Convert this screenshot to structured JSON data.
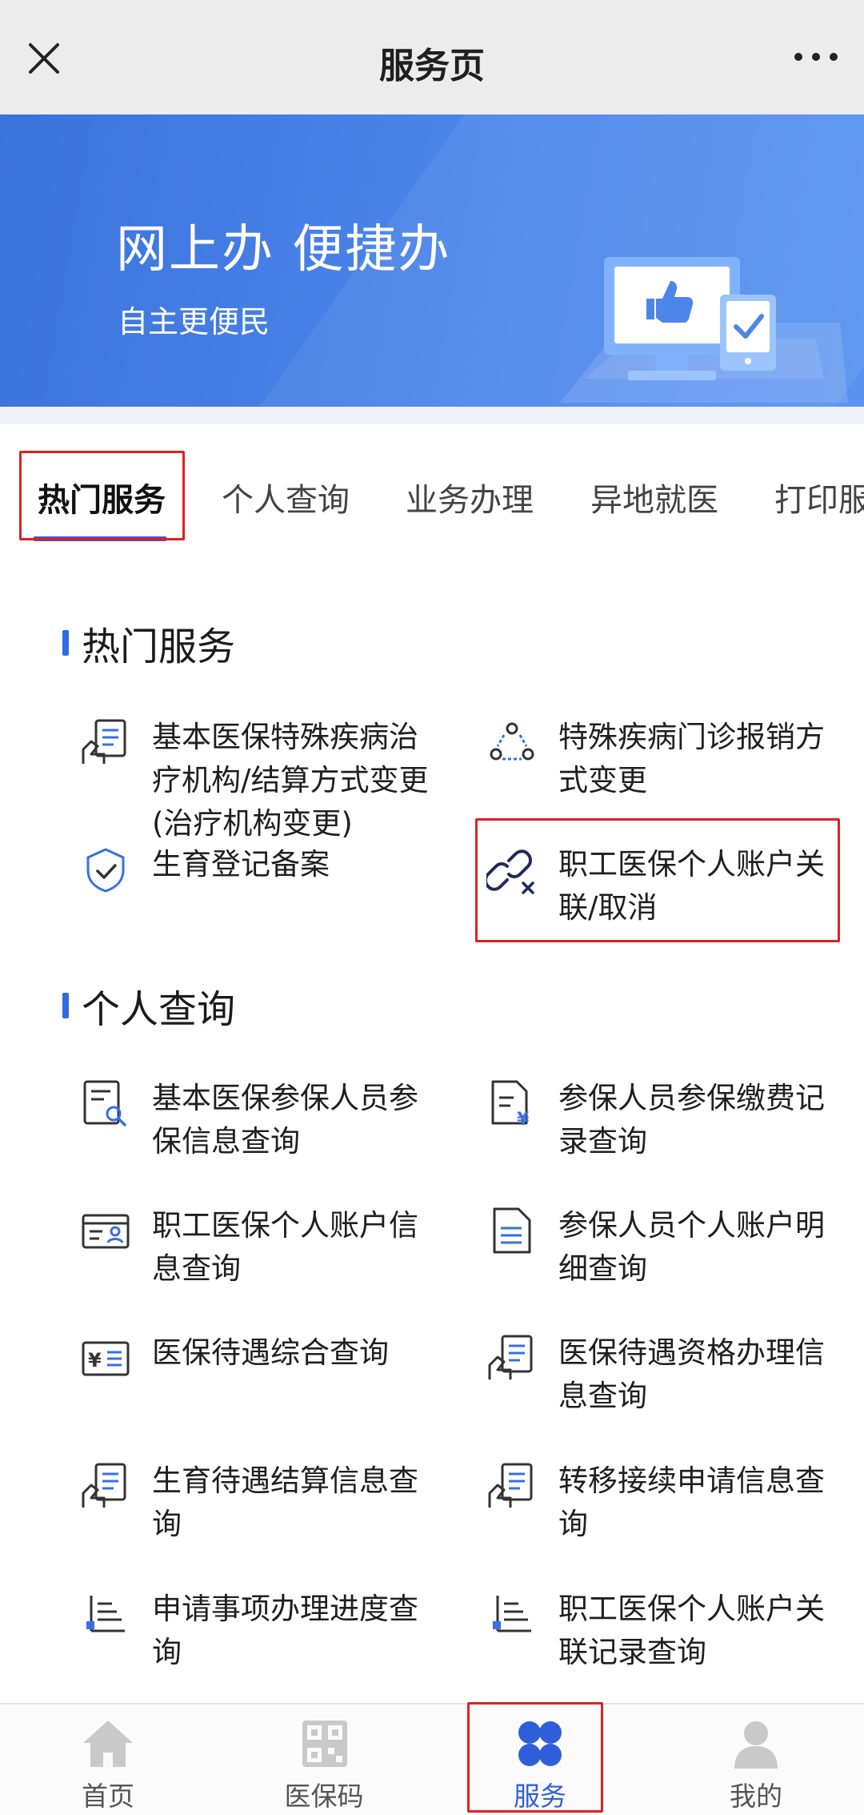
{
  "topbar": {
    "title": "服务页",
    "close_icon": "close-icon",
    "more_icon": "more-dots-icon"
  },
  "banner": {
    "headline": "网上办 便捷办",
    "subtitle": "自主更便民",
    "illustration": "computer-thumbs-up-illustration"
  },
  "tabs": [
    {
      "label": "热门服务",
      "active": true
    },
    {
      "label": "个人查询",
      "active": false
    },
    {
      "label": "业务办理",
      "active": false
    },
    {
      "label": "异地就医",
      "active": false
    },
    {
      "label": "打印服",
      "active": false
    }
  ],
  "sections": [
    {
      "title": "热门服务",
      "items": [
        {
          "label": "基本医保特殊疾病治疗机构/结算方式变更(治疗机构变更)",
          "icon": "document-hand-icon"
        },
        {
          "label": "特殊疾病门诊报销方式变更",
          "icon": "nodes-triangle-icon"
        },
        {
          "label": "生育登记备案",
          "icon": "shield-check-icon"
        },
        {
          "label": "职工医保个人账户关联/取消",
          "icon": "link-cancel-icon"
        }
      ]
    },
    {
      "title": "个人查询",
      "items": [
        {
          "label": "基本医保参保人员参保信息查询",
          "icon": "doc-search-icon"
        },
        {
          "label": "参保人员参保缴费记录查询",
          "icon": "doc-yen-icon"
        },
        {
          "label": "职工医保个人账户信息查询",
          "icon": "id-card-icon"
        },
        {
          "label": "参保人员个人账户明细查询",
          "icon": "document-icon"
        },
        {
          "label": "医保待遇综合查询",
          "icon": "yen-card-icon"
        },
        {
          "label": "医保待遇资格办理信息查询",
          "icon": "document-hand-icon"
        },
        {
          "label": "生育待遇结算信息查询",
          "icon": "document-hand-icon"
        },
        {
          "label": "转移接续申请信息查询",
          "icon": "document-hand-icon"
        },
        {
          "label": "申请事项办理进度查询",
          "icon": "progress-list-icon"
        },
        {
          "label": "职工医保个人账户关联记录查询",
          "icon": "progress-list-icon"
        }
      ]
    }
  ],
  "bottom_nav": [
    {
      "label": "首页",
      "icon": "home-icon",
      "active": false
    },
    {
      "label": "医保码",
      "icon": "qr-code-icon",
      "active": false
    },
    {
      "label": "服务",
      "icon": "four-petal-icon",
      "active": true
    },
    {
      "label": "我的",
      "icon": "user-icon",
      "active": false
    }
  ],
  "colors": {
    "accent": "#2f6ce0",
    "banner": "#4c86ea",
    "highlight": "#e02020"
  }
}
